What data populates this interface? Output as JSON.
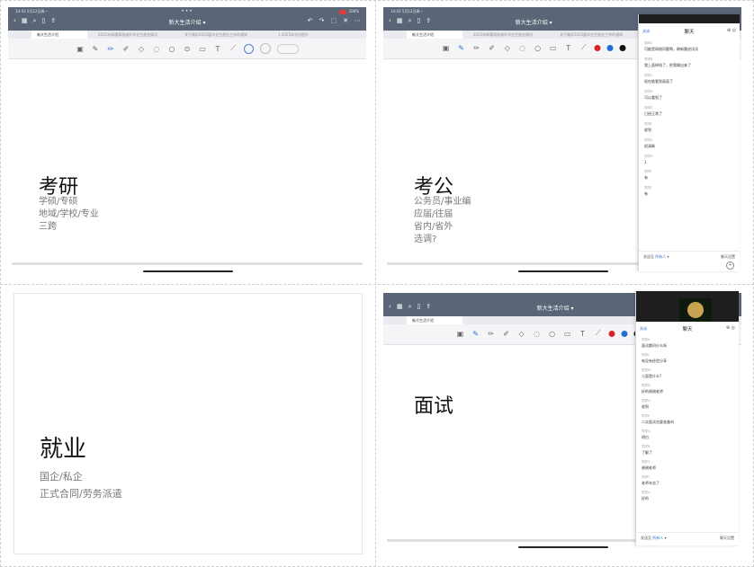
{
  "app": {
    "doc_title": "新大生活介绍",
    "status_left": "14:43  5月12日周一",
    "status_right": "100%",
    "tabs": [
      "新大生活介绍",
      "2025年新疆高校省外毕业生就业情况",
      "关于做好2025届毕业生就业工作的通知",
      "1.2025年学历提升"
    ]
  },
  "toolbar": {
    "colors": [
      "#d8232a",
      "#1f6fd1",
      "#111111"
    ]
  },
  "slides": [
    {
      "heading": "考研",
      "lines": [
        "学硕/专硕",
        "地域/学校/专业",
        "三跨"
      ]
    },
    {
      "heading": "考公",
      "lines": [
        "公务员/事业编",
        "应届/往届",
        "省内/省外",
        "选调?"
      ]
    },
    {
      "heading": "就业",
      "lines": [
        "国企/私企",
        "正式合同/劳务派遣"
      ]
    },
    {
      "heading": "面试",
      "lines": []
    }
  ],
  "chat": {
    "close": "关闭",
    "title": "聊天",
    "footer_send": "发送至",
    "footer_target": "所有人",
    "footer_right": "聊天设置",
    "panel2_messages": [
      {
        "who": "同学A",
        "text": "可能是网络问题啊，刷新重进试试"
      },
      {
        "who": "同学B",
        "text": "我上面掉线了，把我踢出来了"
      },
      {
        "who": "同学C",
        "text": "现在能看到画面了"
      },
      {
        "who": "同学D",
        "text": "可以看到了"
      },
      {
        "who": "同学E",
        "text": "已经正常了"
      },
      {
        "who": "同学F",
        "text": "收到"
      },
      {
        "who": "同学G",
        "text": "很清晰"
      },
      {
        "who": "同学H",
        "text": "1"
      },
      {
        "who": "同学I",
        "text": "有"
      },
      {
        "who": "同学J",
        "text": "有"
      }
    ],
    "panel4_messages": [
      {
        "who": "同学K",
        "text": "面试都问什么呀"
      },
      {
        "who": "同学L",
        "text": "有没有经验分享"
      },
      {
        "who": "同学M",
        "text": "二面是什么?"
      },
      {
        "who": "同学N",
        "text": "好的谢谢老师"
      },
      {
        "who": "同学O",
        "text": "收到"
      },
      {
        "who": "同学P",
        "text": "二次面试也要准备吗"
      },
      {
        "who": "同学Q",
        "text": "明白"
      },
      {
        "who": "同学R",
        "text": "了解了"
      },
      {
        "who": "同学S",
        "text": "谢谢老师"
      },
      {
        "who": "同学T",
        "text": "老师辛苦了"
      },
      {
        "who": "同学U",
        "text": "好的"
      }
    ]
  }
}
